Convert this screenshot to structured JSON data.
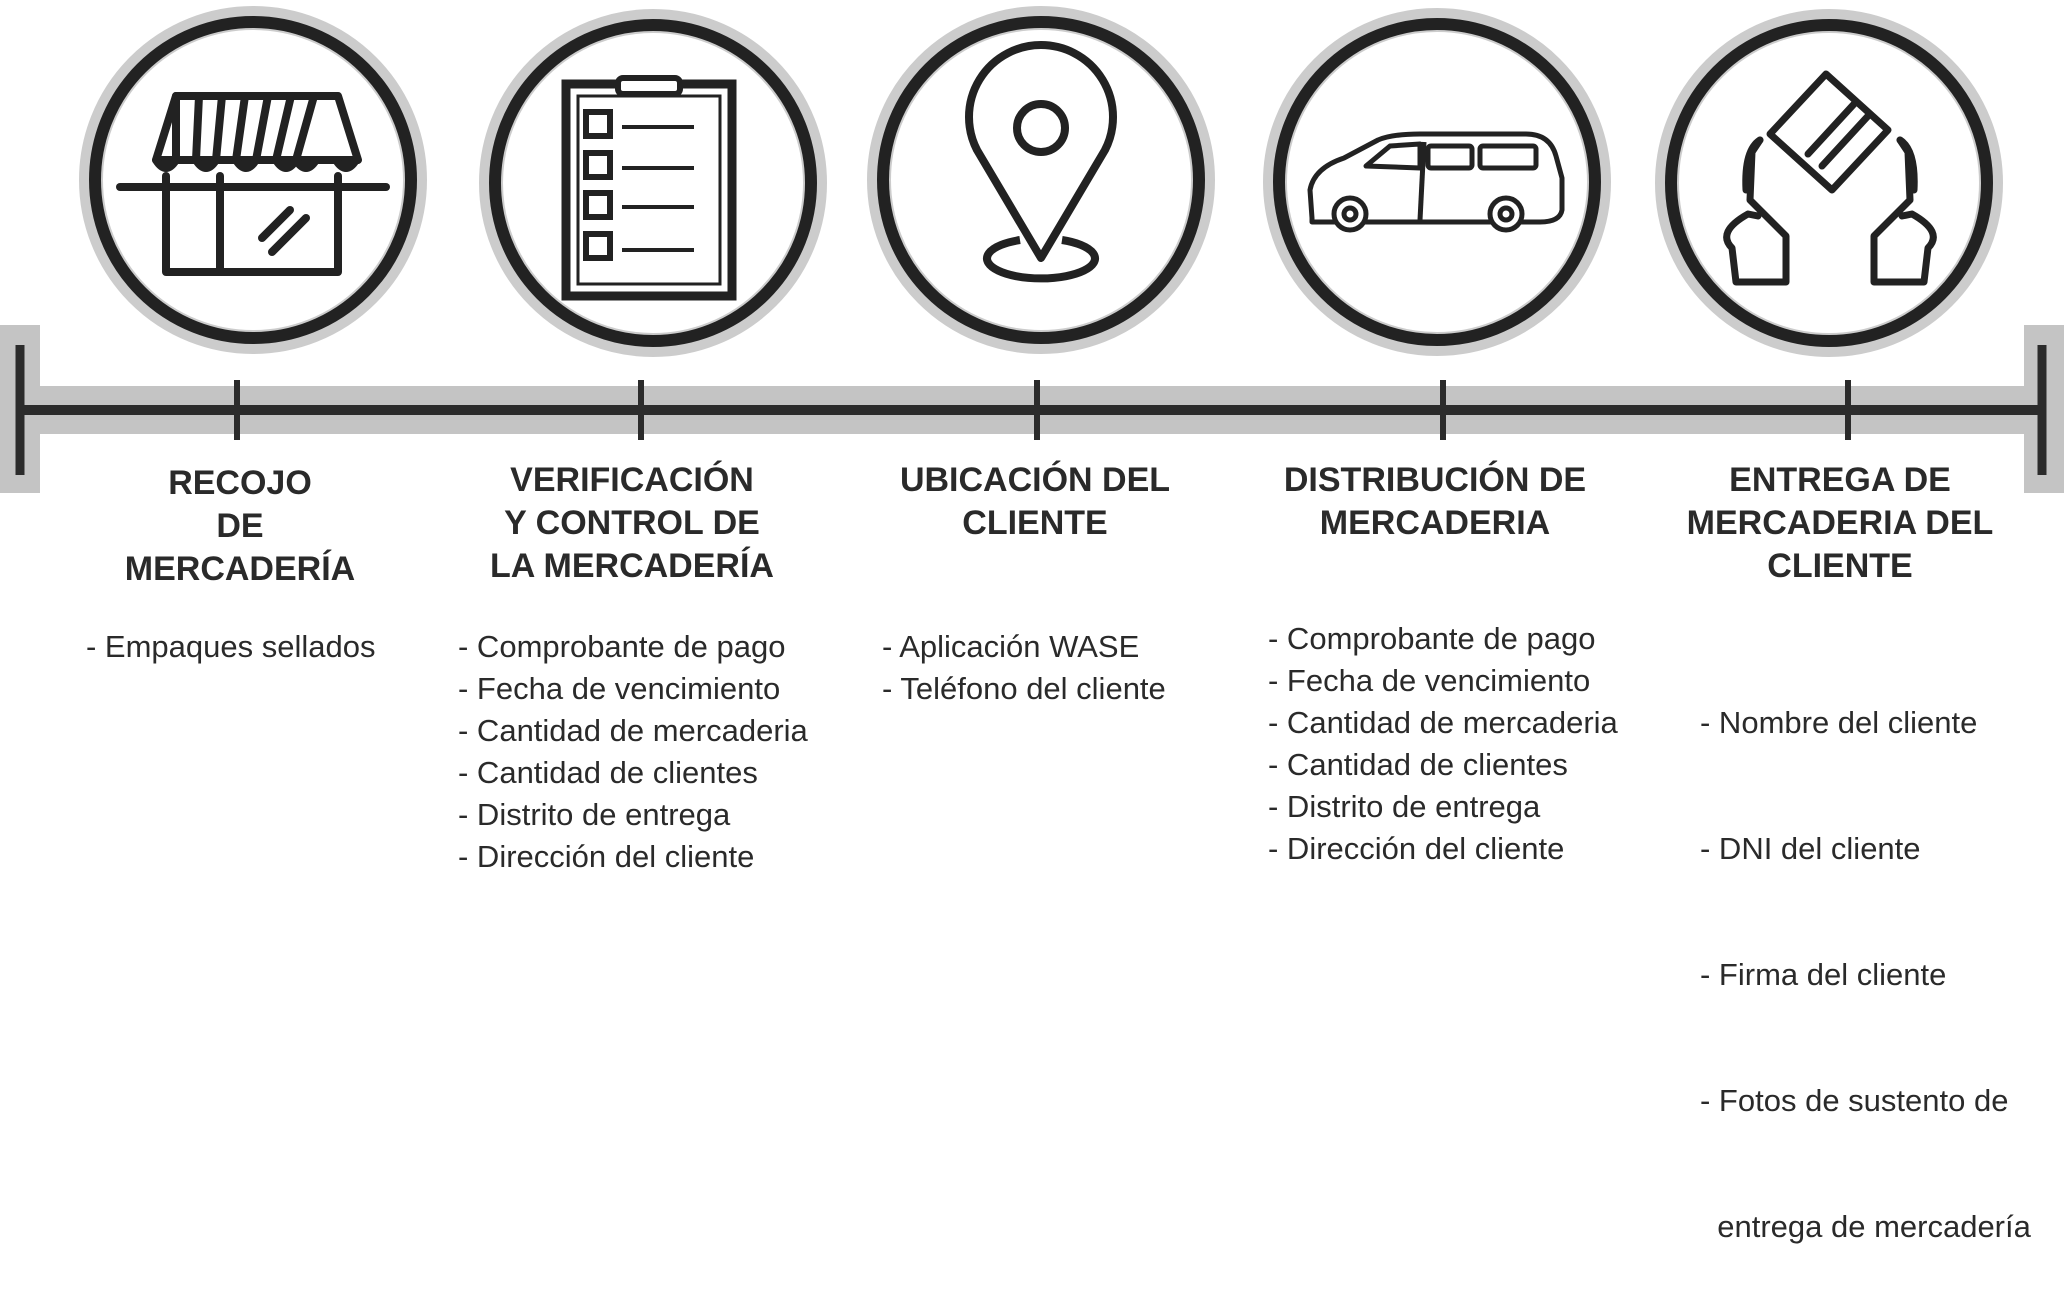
{
  "colors": {
    "ring_outer": "#cccccc",
    "ring_inner": "#222222",
    "timeline_band": "#c4c4c4",
    "timeline_line": "#2b2b2b",
    "text": "#2a2a2a"
  },
  "stages": [
    {
      "icon": "storefront-icon",
      "title_lines": [
        "RECOJO",
        "DE",
        "MERCADERÍA"
      ],
      "items": [
        "- Empaques sellados"
      ]
    },
    {
      "icon": "clipboard-checklist-icon",
      "title_lines": [
        "VERIFICACIÓN",
        "Y CONTROL DE",
        "LA MERCADERÍA"
      ],
      "items": [
        "- Comprobante de pago",
        "- Fecha de vencimiento",
        "- Cantidad de mercaderia",
        "- Cantidad de clientes",
        "- Distrito de entrega",
        "- Dirección del cliente"
      ]
    },
    {
      "icon": "location-pin-icon",
      "title_lines": [
        "UBICACIÓN DEL",
        "CLIENTE"
      ],
      "items": [
        "- Aplicación WASE",
        "- Teléfono del cliente"
      ]
    },
    {
      "icon": "van-icon",
      "title_lines": [
        "DISTRIBUCIÓN DE",
        "MERCADERIA"
      ],
      "items": [
        "- Comprobante de pago",
        "- Fecha de vencimiento",
        "- Cantidad de mercaderia",
        "- Cantidad de clientes",
        "- Distrito de entrega",
        "- Dirección del cliente"
      ]
    },
    {
      "icon": "hands-package-icon",
      "title_lines": [
        "ENTREGA DE",
        "MERCADERIA DEL",
        "CLIENTE"
      ],
      "items": [
        "- Nombre del cliente",
        "- DNI del cliente",
        "- Firma del cliente",
        "- Fotos de sustento de",
        "  entrega de mercadería"
      ]
    }
  ]
}
